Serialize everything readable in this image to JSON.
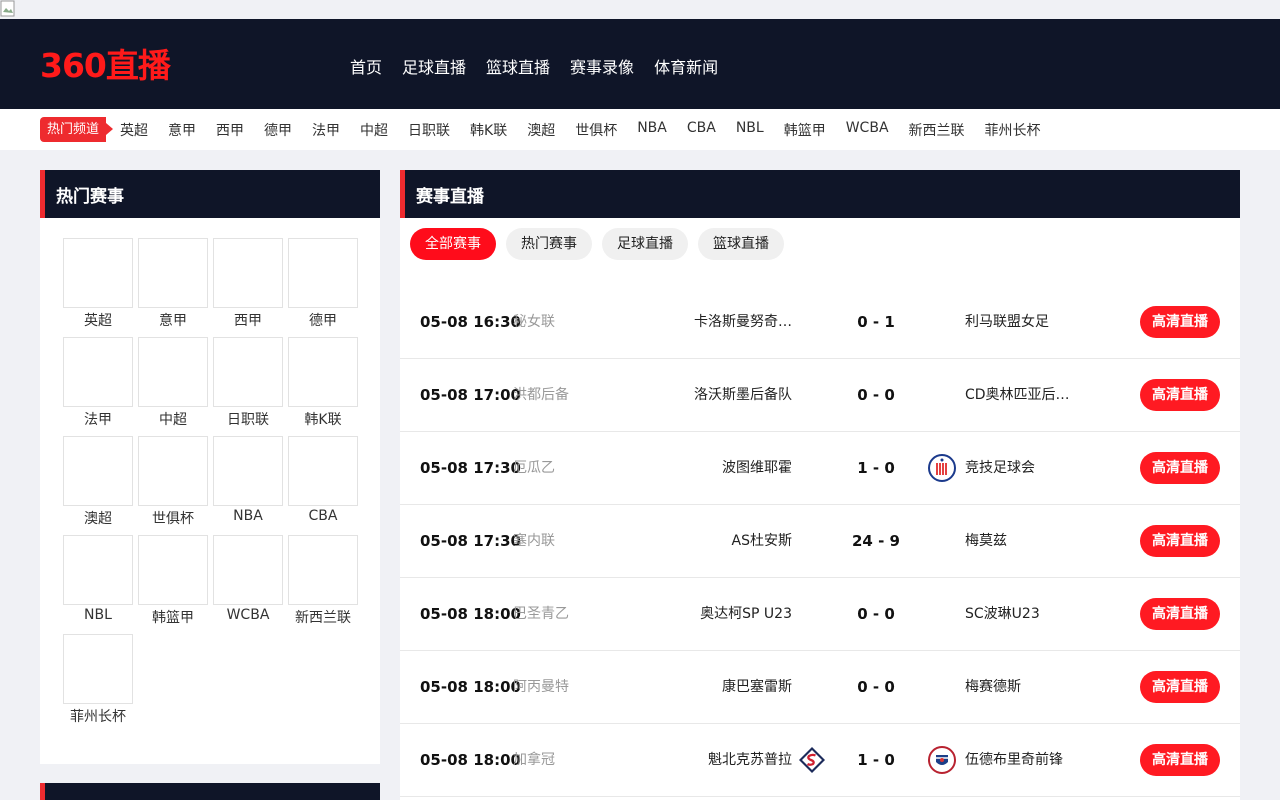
{
  "site": {
    "logo": "360直播"
  },
  "nav": [
    "首页",
    "足球直播",
    "篮球直播",
    "赛事录像",
    "体育新闻"
  ],
  "channels": {
    "tag": "热门频道",
    "links": [
      "英超",
      "意甲",
      "西甲",
      "德甲",
      "法甲",
      "中超",
      "日职联",
      "韩K联",
      "澳超",
      "世俱杯",
      "NBA",
      "CBA",
      "NBL",
      "韩篮甲",
      "WCBA",
      "新西兰联",
      "菲州长杯"
    ]
  },
  "hot": {
    "title": "热门赛事",
    "leagues": [
      "英超",
      "意甲",
      "西甲",
      "德甲",
      "法甲",
      "中超",
      "日职联",
      "韩K联",
      "澳超",
      "世俱杯",
      "NBA",
      "CBA",
      "NBL",
      "韩篮甲",
      "WCBA",
      "新西兰联",
      "菲州长杯"
    ]
  },
  "live": {
    "title": "赛事直播",
    "filters": [
      "全部赛事",
      "热门赛事",
      "足球直播",
      "篮球直播"
    ],
    "active_filter": 0,
    "watch_label": "高清直播",
    "matches": [
      {
        "time": "05-08 16:30",
        "league": "秘女联",
        "home": "卡洛斯曼努奇…",
        "home_score": "0",
        "away_score": "1",
        "away": "利马联盟女足",
        "home_logo": null,
        "away_logo": null
      },
      {
        "time": "05-08 17:00",
        "league": "洪都后备",
        "home": "洛沃斯墨后备队",
        "home_score": "0",
        "away_score": "0",
        "away": "CD奥林匹亚后…",
        "home_logo": null,
        "away_logo": null
      },
      {
        "time": "05-08 17:30",
        "league": "厄瓜乙",
        "home": "波图维耶霍",
        "home_score": "1",
        "away_score": "0",
        "away": "竞技足球会",
        "home_logo": null,
        "away_logo": "striped-crest-icon"
      },
      {
        "time": "05-08 17:30",
        "league": "塞内联",
        "home": "AS杜安斯",
        "home_score": "24",
        "away_score": "9",
        "away": "梅莫兹",
        "home_logo": null,
        "away_logo": null
      },
      {
        "time": "05-08 18:00",
        "league": "巴圣青乙",
        "home": "奥达柯SP U23",
        "home_score": "0",
        "away_score": "0",
        "away": "SC波琳U23",
        "home_logo": null,
        "away_logo": null
      },
      {
        "time": "05-08 18:00",
        "league": "阿丙曼特",
        "home": "康巴塞雷斯",
        "home_score": "0",
        "away_score": "0",
        "away": "梅赛德斯",
        "home_logo": null,
        "away_logo": null
      },
      {
        "time": "05-08 18:00",
        "league": "加拿冠",
        "home": "魁北克苏普拉",
        "home_score": "1",
        "away_score": "0",
        "away": "伍德布里奇前锋",
        "home_logo": "diamond-s-crest-icon",
        "away_logo": "round-crest-icon"
      }
    ]
  }
}
